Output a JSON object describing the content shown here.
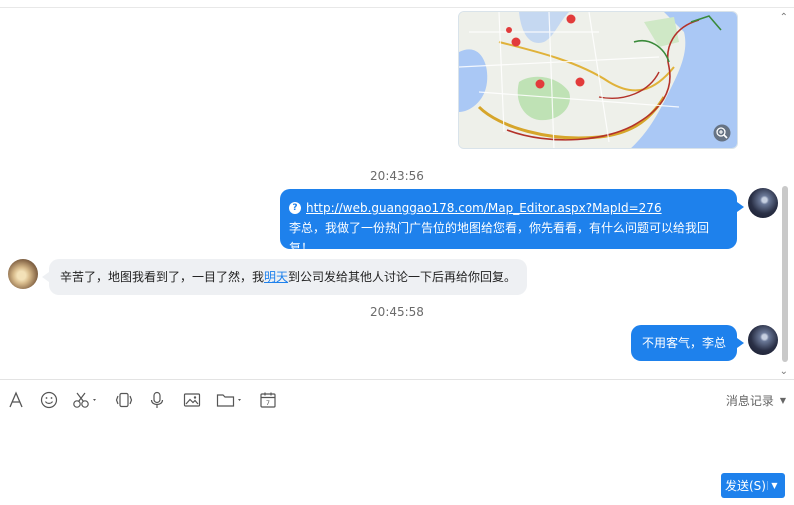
{
  "chat": {
    "messages": [
      {
        "type": "map-image"
      },
      {
        "type": "timestamp",
        "text": "20:43:56"
      },
      {
        "type": "outgoing",
        "link": "http://web.guanggao178.com/Map_Editor.aspx?MapId=276",
        "text": "李总，我做了一份热门广告位的地图给您看，你先看看，有什么问题可以给我回复！"
      },
      {
        "type": "incoming",
        "text_before": "辛苦了，地图我看到了，一目了然，我",
        "highlight": "明天",
        "text_after": "到公司发给其他人讨论一下后再给你回复。"
      },
      {
        "type": "timestamp",
        "text": "20:45:58"
      },
      {
        "type": "outgoing",
        "text": "不用客气，李总"
      }
    ]
  },
  "toolbar": {
    "icons": [
      "font-icon",
      "emoji-icon",
      "screenshot-icon",
      "shake-icon",
      "voice-icon",
      "image-icon",
      "folder-icon",
      "calendar-icon"
    ],
    "history_label": "消息记录"
  },
  "send": {
    "label": "发送(S)"
  },
  "colors": {
    "accent": "#1e81ec",
    "incoming_bubble": "#eef0f3"
  }
}
